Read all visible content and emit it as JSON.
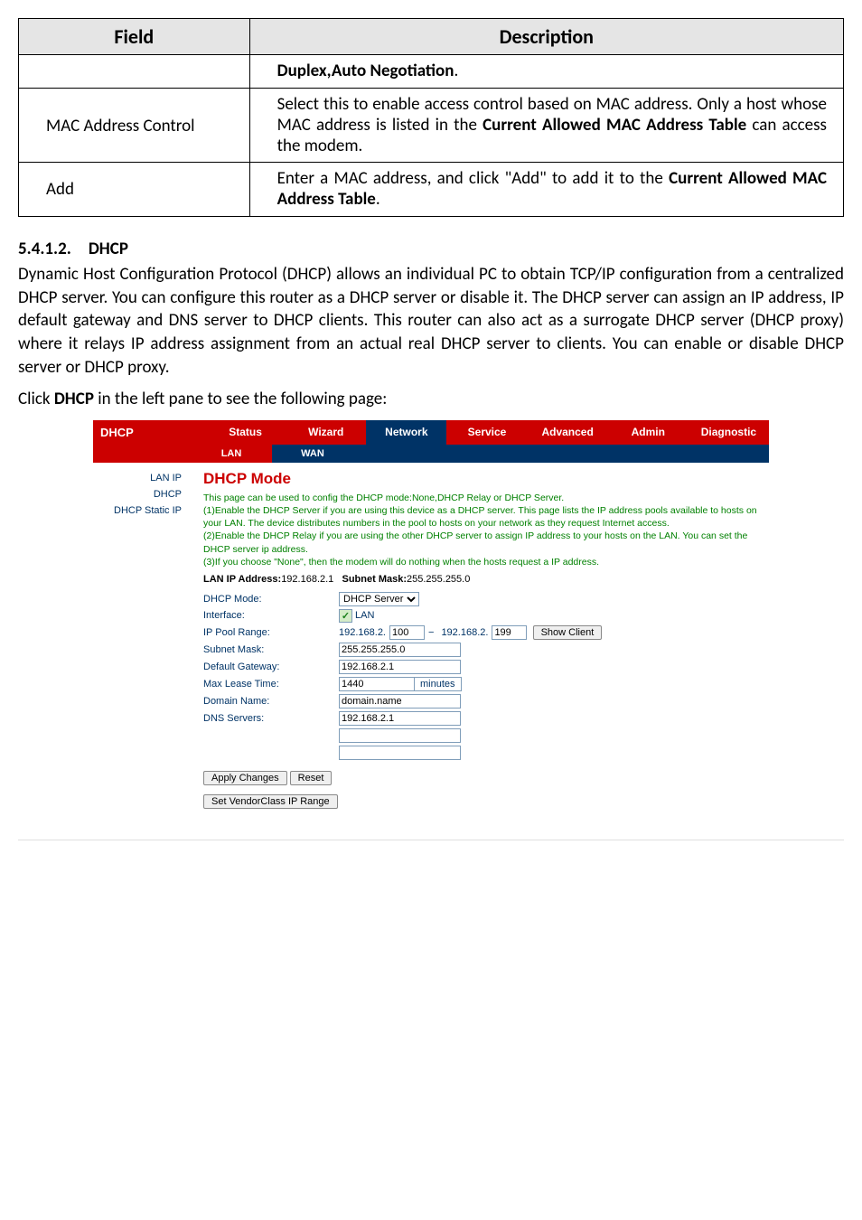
{
  "desc_table": {
    "head_field": "Field",
    "head_desc": "Description",
    "row0_desc_prefix": "",
    "row0_desc_bold": "Duplex,Auto Negotiation",
    "row0_desc_suffix": ".",
    "row1_field": "MAC Address Control",
    "row1_desc_p1": "Select this to enable access control based on MAC address. Only a host whose MAC address is listed in the ",
    "row1_desc_b": "Current Allowed MAC Address Table",
    "row1_desc_p2": " can access the modem.",
    "row2_field": "Add",
    "row2_desc_p1": "Enter a MAC address, and click \"Add\" to add it to the ",
    "row2_desc_b": "Current Allowed MAC Address Table",
    "row2_desc_p2": "."
  },
  "section": {
    "number": "5.4.1.2. DHCP",
    "para": "Dynamic Host Configuration Protocol (DHCP) allows an individual PC to obtain TCP/IP configuration from a centralized DHCP server. You can configure this router as a DHCP server or disable it. The DHCP server can assign an IP address, IP default gateway and DNS server to DHCP clients. This router can also act as a surrogate DHCP server (DHCP proxy) where it relays IP address assignment from an actual real DHCP server to clients. You can enable or disable DHCP server or DHCP proxy.",
    "click_line_p1": "Click ",
    "click_line_b": "DHCP",
    "click_line_p2": " in the left pane to see the following page:"
  },
  "app": {
    "title": "DHCP",
    "tabs": [
      "Status",
      "Wizard",
      "Network",
      "Service",
      "Advanced",
      "Admin",
      "Diagnostic"
    ],
    "subtabs": [
      "LAN",
      "WAN"
    ],
    "sidebar": [
      "LAN IP",
      "DHCP",
      "DHCP Static IP"
    ],
    "page_title": "DHCP Mode",
    "help_html": "This page can be used to config the DHCP mode:None,DHCP Relay or DHCP Server.\n(1)Enable the DHCP Server if you are using this device as a DHCP server. This page lists the IP address pools available to hosts on your LAN. The device distributes numbers in the pool to hosts on your network as they request Internet access.\n(2)Enable the DHCP Relay if you are using the other DHCP server to assign IP address to your hosts on the LAN. You can set the DHCP server ip address.\n(3)If you choose \"None\", then the modem will do nothing when the hosts request a IP address.",
    "lan_line_p1": "LAN IP Address:",
    "lan_line_v1": "192.168.2.1",
    "lan_line_p2": "Subnet Mask:",
    "lan_line_v2": "255.255.255.0",
    "form": {
      "dhcp_mode_label": "DHCP Mode:",
      "dhcp_mode_value": "DHCP Server",
      "interface_label": "Interface:",
      "interface_value": "LAN",
      "pool_label": "IP Pool Range:",
      "pool_prefix": "192.168.2.",
      "pool_start": "100",
      "pool_dash": "−",
      "pool_end": "199",
      "show_client_btn": "Show Client",
      "subnet_label": "Subnet Mask:",
      "subnet_value": "255.255.255.0",
      "gateway_label": "Default Gateway:",
      "gateway_value": "192.168.2.1",
      "lease_label": "Max Lease Time:",
      "lease_value": "1440",
      "lease_unit": "minutes",
      "domain_label": "Domain Name:",
      "domain_value": "domain.name",
      "dns_label": "DNS Servers:",
      "dns1": "192.168.2.1",
      "apply_btn": "Apply Changes",
      "reset_btn": "Reset",
      "vendor_btn": "Set VendorClass IP Range"
    }
  }
}
